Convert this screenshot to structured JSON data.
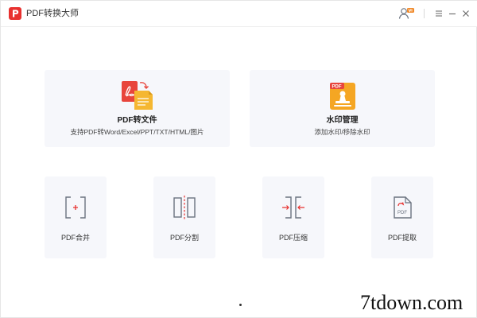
{
  "app": {
    "title": "PDF转换大师",
    "logo_icon": "pdf-logo-icon",
    "brand_color": "#e8312f"
  },
  "titlebar": {
    "user_icon": "user-vip-icon",
    "menu_icon": "hamburger-menu-icon",
    "minimize_icon": "minimize-icon",
    "close_icon": "close-icon"
  },
  "features": {
    "pdf_to_file": {
      "title": "PDF转文件",
      "subtitle": "支持PDF转Word/Excel/PPT/TXT/HTML/图片",
      "icon": "pdf-convert-icon"
    },
    "watermark": {
      "title": "水印管理",
      "subtitle": "添加水印/移除水印",
      "icon": "pdf-watermark-icon"
    }
  },
  "tools": [
    {
      "label": "PDF合并",
      "icon": "merge-icon"
    },
    {
      "label": "PDF分割",
      "icon": "split-icon"
    },
    {
      "label": "PDF压缩",
      "icon": "compress-icon"
    },
    {
      "label": "PDF提取",
      "icon": "extract-icon"
    }
  ],
  "watermark_text": "7tdown.com",
  "colors": {
    "accent_red": "#e8312f",
    "icon_gray": "#6b7380",
    "card_bg": "#f6f7fb",
    "watermark_orange": "#f5a623"
  }
}
